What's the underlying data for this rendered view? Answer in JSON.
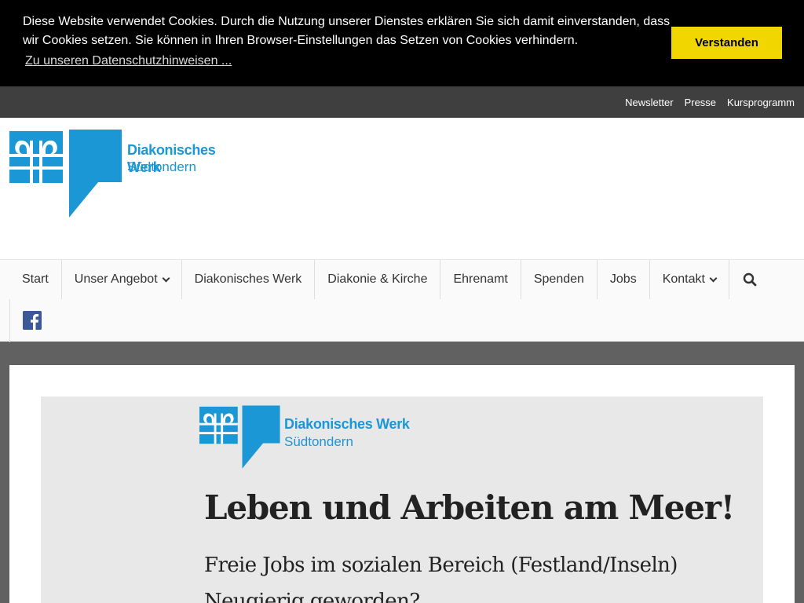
{
  "cookie": {
    "message": "Diese Website verwendet Cookies. Durch die Nutzung unserer Dienstes erklären Sie sich damit einverstanden, dass wir Cookies setzen. Sie können in Ihren Browser-Einstellungen das Setzen von Cookies verhindern.",
    "link": "Zu unseren Datenschutzhinweisen ...",
    "button": "Verstanden",
    "button_color": "#f1d600"
  },
  "topbar": {
    "links": [
      "Newsletter",
      "Presse",
      "Kursprogramm"
    ]
  },
  "brand": {
    "name": "Diakonisches Werk",
    "sub": "Südtondern",
    "color": "#1a97d4"
  },
  "nav": {
    "items": [
      "Start",
      "Unser Angebot",
      "Diakonisches Werk",
      "Diakonie & Kirche",
      "Ehrenamt",
      "Spenden",
      "Jobs",
      "Kontakt"
    ],
    "search_icon": "search-icon",
    "social_icon": "facebook-icon"
  },
  "hero": {
    "title": "Leben und Arbeiten am Meer!",
    "line1": "Freie Jobs im sozialen Bereich (Festland/Inseln)",
    "line2": "Neugierig geworden?"
  }
}
